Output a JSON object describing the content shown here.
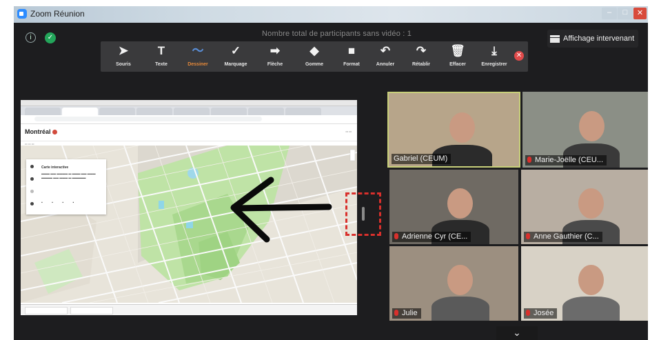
{
  "window": {
    "title": "Zoom Réunion",
    "controls": [
      "–",
      "□",
      "✕"
    ]
  },
  "top_bar": {
    "participants_note": "Nombre total de participants sans vidéo : 1",
    "view_button_label": "Affichage intervenant"
  },
  "annotation_toolbar": {
    "tools": [
      {
        "label": "Souris",
        "icon": "mouse-pointer-icon",
        "glyph": "➤"
      },
      {
        "label": "Texte",
        "icon": "text-icon",
        "glyph": "T"
      },
      {
        "label": "Dessiner",
        "icon": "draw-icon",
        "glyph": "〜",
        "active": true
      },
      {
        "label": "Marquage",
        "icon": "checkmark-icon",
        "glyph": "✓"
      },
      {
        "label": "Flèche",
        "icon": "arrow-icon",
        "glyph": "➡"
      },
      {
        "label": "Gomme",
        "icon": "eraser-icon",
        "glyph": "◆"
      },
      {
        "label": "Format",
        "icon": "format-icon",
        "glyph": "■"
      },
      {
        "label": "Annuler",
        "icon": "undo-icon",
        "glyph": "↶"
      },
      {
        "label": "Rétablir",
        "icon": "redo-icon",
        "glyph": "↷"
      },
      {
        "label": "Effacer",
        "icon": "trash-icon",
        "glyph": "🗑"
      },
      {
        "label": "Enregistrer",
        "icon": "save-icon",
        "glyph": "⤓"
      }
    ],
    "close_glyph": "✕"
  },
  "shared_screen": {
    "site_logo": "Montréal",
    "map_panel": {
      "title": "Carte interactive"
    }
  },
  "participants": [
    {
      "name": "Gabriel (CEUM)",
      "muted": false,
      "active_speaker": true,
      "bg": "#b7a58a",
      "shirt": "#2b2b2b"
    },
    {
      "name": "Marie-Joëlle (CEU...",
      "muted": true,
      "bg": "#8b8f86",
      "shirt": "#3a3a3a"
    },
    {
      "name": "Adrienne Cyr (CE...",
      "muted": true,
      "bg": "#6f6a63",
      "shirt": "#2a2a2a"
    },
    {
      "name": "Anne Gauthier (C...",
      "muted": true,
      "bg": "#b8aea2",
      "shirt": "#4a4a4a"
    },
    {
      "name": "Julie",
      "muted": true,
      "bg": "#9c8f80",
      "shirt": "#5a5a5a"
    },
    {
      "name": "Josée",
      "muted": true,
      "bg": "#d8d2c6",
      "shirt": "#6b6b6b"
    }
  ],
  "colors": {
    "accent_annotation": "#d9302c",
    "active_tool": "#e5893a",
    "active_speaker_border": "#c8d07a"
  }
}
